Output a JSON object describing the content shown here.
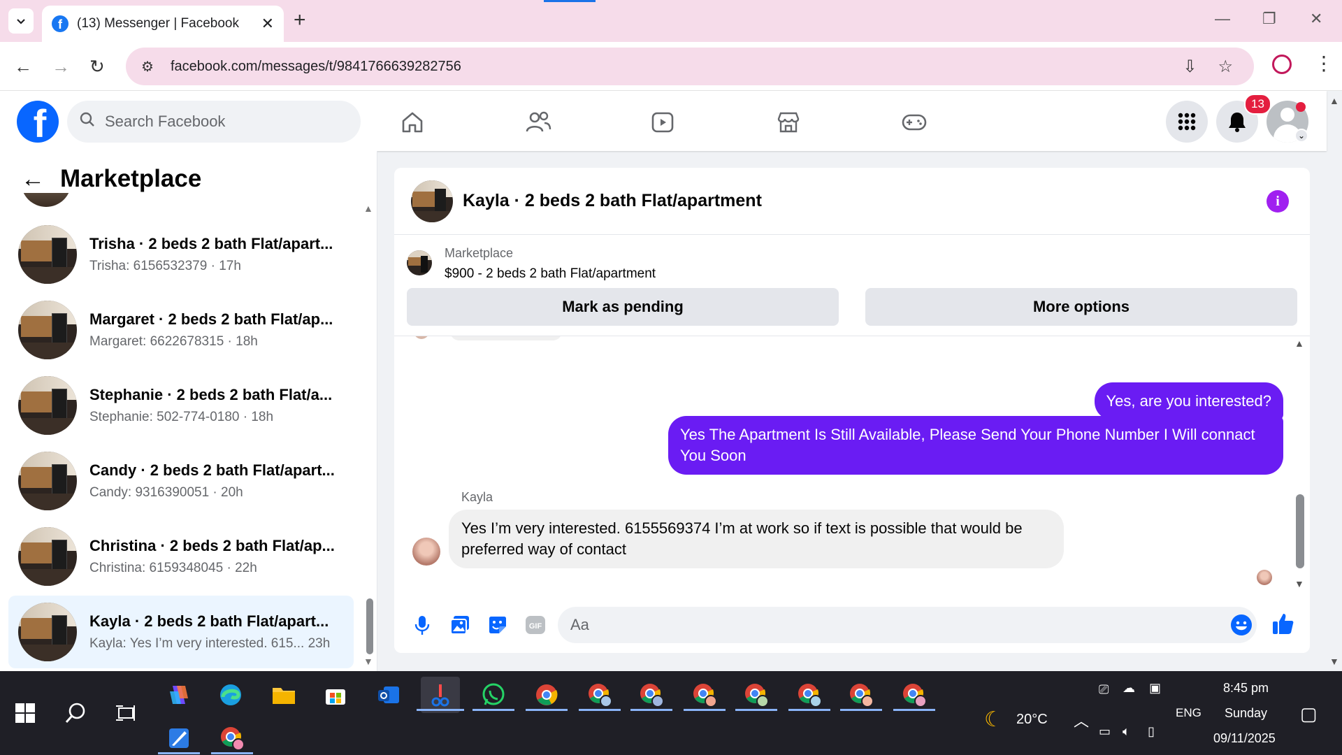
{
  "browser": {
    "tab_title": "(13) Messenger | Facebook",
    "url": "facebook.com/messages/t/9841766639282756",
    "new_tab": "+",
    "close_tab": "✕"
  },
  "fb": {
    "logo": "f",
    "search_placeholder": "Search Facebook",
    "notification_count": "13"
  },
  "sidebar": {
    "title": "Marketplace",
    "conversations": [
      {
        "title": "Trisha · 2 beds 2 bath Flat/apart...",
        "subtitle": "Trisha: 6156532379 · 17h"
      },
      {
        "title": "Margaret · 2 beds 2 bath Flat/ap...",
        "subtitle": "Margaret: 6622678315 · 18h"
      },
      {
        "title": "Stephanie · 2 beds 2 bath Flat/a...",
        "subtitle": "Stephanie: 502-774-0180 · 18h"
      },
      {
        "title": "Candy · 2 beds 2 bath Flat/apart...",
        "subtitle": "Candy: 9316390051 · 20h"
      },
      {
        "title": "Christina · 2 beds 2 bath Flat/ap...",
        "subtitle": "Christina: 6159348045 · 22h"
      },
      {
        "title": "Kayla · 2 beds 2 bath Flat/apart...",
        "subtitle": "Kayla: Yes I’m very interested. 615...  23h"
      }
    ]
  },
  "chat": {
    "title": "Kayla · 2 beds 2 bath Flat/apartment",
    "marketplace_label": "Marketplace",
    "listing": "$900 - 2 beds 2 bath Flat/apartment",
    "mark_pending_label": "Mark as pending",
    "more_options_label": "More options",
    "messages": [
      {
        "from": "me",
        "text": "Yes, are you interested?"
      },
      {
        "from": "me",
        "text": "Yes The Apartment Is Still Available, Please Send Your Phone Number I Will connact You Soon"
      },
      {
        "from": "Kayla",
        "text": "Yes I’m very interested. 6155569374 I’m at work so if text is possible that would be preferred way of contact"
      }
    ],
    "sender_name": "Kayla",
    "composer_placeholder": "Aa"
  },
  "taskbar": {
    "weather": "20°C",
    "language": "ENG",
    "time": "8:45 pm",
    "day": "Sunday",
    "date": "09/11/2025"
  },
  "colors": {
    "fb_blue": "#0866ff",
    "messenger_purple": "#6a1cf3",
    "tab_pink": "#f6dcea"
  }
}
